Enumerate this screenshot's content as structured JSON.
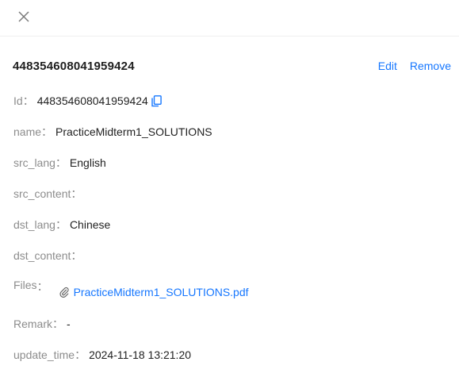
{
  "header": {
    "close_icon": "close-icon"
  },
  "title": "448354608041959424",
  "actions": {
    "edit_label": "Edit",
    "remove_label": "Remove"
  },
  "separator": "：",
  "fields": {
    "id": {
      "label": "Id",
      "value": "448354608041959424",
      "icon": "copy-icon"
    },
    "name": {
      "label": "name",
      "value": "PracticeMidterm1_SOLUTIONS"
    },
    "src_lang": {
      "label": "src_lang",
      "value": "English"
    },
    "src_content": {
      "label": "src_content",
      "value": ""
    },
    "dst_lang": {
      "label": "dst_lang",
      "value": "Chinese"
    },
    "dst_content": {
      "label": "dst_content",
      "value": ""
    },
    "files": {
      "label": "Files",
      "file_name": "PracticeMidterm1_SOLUTIONS.pdf",
      "icon": "paperclip-icon"
    },
    "remark": {
      "label": "Remark",
      "value": "-"
    },
    "update_time": {
      "label": "update_time",
      "value": "2024-11-18 13:21:20"
    }
  },
  "colors": {
    "accent": "#1677ff",
    "label": "#8c8c8c",
    "text": "#1f1f1f"
  }
}
